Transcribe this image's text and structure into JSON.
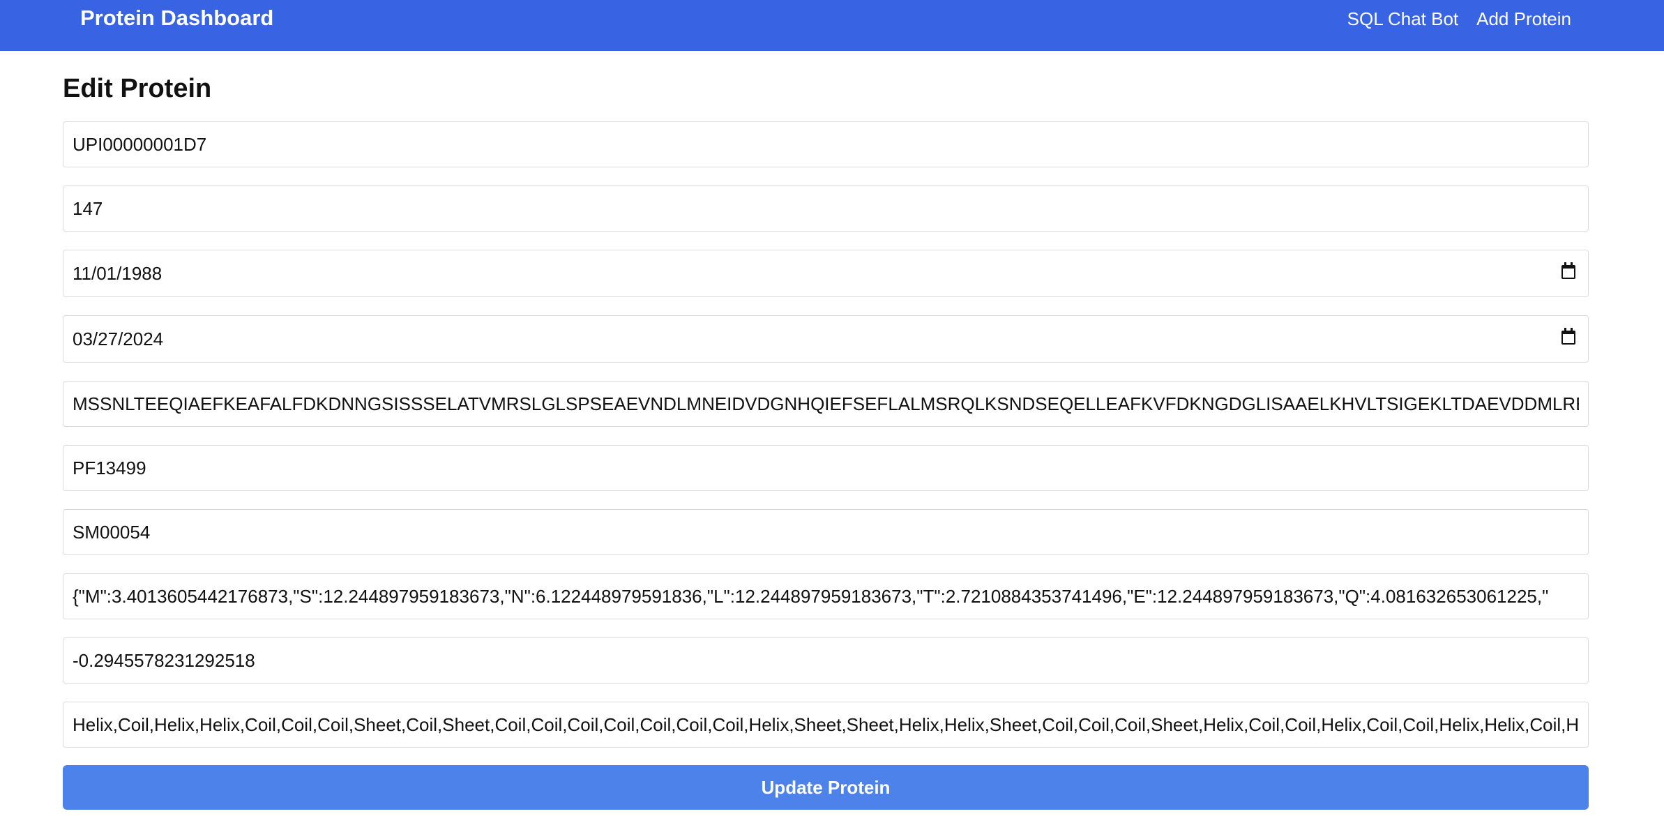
{
  "navbar": {
    "brand": "Protein Dashboard",
    "links": [
      "SQL Chat Bot",
      "Add Protein"
    ]
  },
  "page": {
    "title": "Edit Protein"
  },
  "form": {
    "fields": [
      {
        "type": "text",
        "value": "UPI00000001D7"
      },
      {
        "type": "text",
        "value": "147"
      },
      {
        "type": "date",
        "value": "11/01/1988"
      },
      {
        "type": "date",
        "value": "03/27/2024"
      },
      {
        "type": "text",
        "value": "MSSNLTEEQIAEFKEAFALFDKDNNGSISSSELATVMRSLGLSPSEAEVNDLMNEIDVDGNHQIEFSEFLALMSRQLKSNDSEQELLEAFKVFDKNGDGLISAAELKHVLTSIGEKLTDAEVDDMLREVSDGSGEIN"
      },
      {
        "type": "text",
        "value": "PF13499"
      },
      {
        "type": "text",
        "value": "SM00054"
      },
      {
        "type": "text",
        "value": "{\"M\":3.4013605442176873,\"S\":12.244897959183673,\"N\":6.122448979591836,\"L\":12.244897959183673,\"T\":2.7210884353741496,\"E\":12.244897959183673,\"Q\":4.081632653061225,\""
      },
      {
        "type": "text",
        "value": "-0.2945578231292518"
      },
      {
        "type": "text",
        "value": "Helix,Coil,Helix,Helix,Coil,Coil,Coil,Sheet,Coil,Sheet,Coil,Coil,Coil,Coil,Coil,Coil,Coil,Helix,Sheet,Sheet,Helix,Helix,Sheet,Coil,Coil,Coil,Sheet,Helix,Coil,Coil,Helix,Coil,Coil,Helix,Helix,Coil,He"
      }
    ],
    "submit_label": "Update Protein"
  },
  "colors": {
    "navbar_bg": "#3864e4",
    "button_bg": "#4d82ea",
    "field_border": "#dcdcdc"
  },
  "icons": {
    "date_picker": "calendar-icon"
  }
}
